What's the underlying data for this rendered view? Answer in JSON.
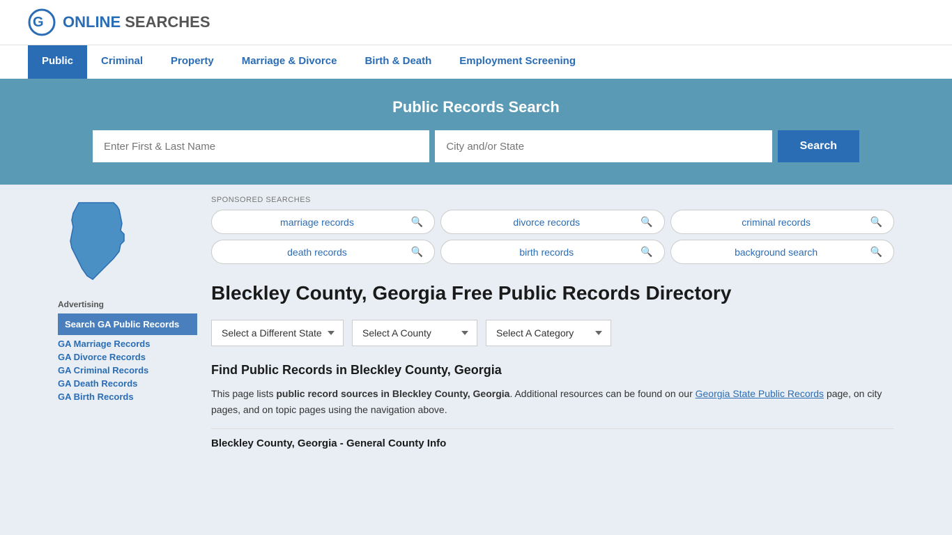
{
  "header": {
    "logo_brand": "ONLINE",
    "logo_brand2": "SEARCHES",
    "nav": [
      {
        "label": "Public",
        "active": true
      },
      {
        "label": "Criminal",
        "active": false
      },
      {
        "label": "Property",
        "active": false
      },
      {
        "label": "Marriage & Divorce",
        "active": false
      },
      {
        "label": "Birth & Death",
        "active": false
      },
      {
        "label": "Employment Screening",
        "active": false
      }
    ]
  },
  "hero": {
    "title": "Public Records Search",
    "name_placeholder": "Enter First & Last Name",
    "city_placeholder": "City and/or State",
    "search_label": "Search"
  },
  "sponsored": {
    "label": "SPONSORED SEARCHES",
    "items": [
      {
        "text": "marriage records"
      },
      {
        "text": "divorce records"
      },
      {
        "text": "criminal records"
      },
      {
        "text": "death records"
      },
      {
        "text": "birth records"
      },
      {
        "text": "background search"
      }
    ]
  },
  "page": {
    "title": "Bleckley County, Georgia Free Public Records Directory",
    "state_dropdown_label": "Select a Different State",
    "county_dropdown_label": "Select A County",
    "category_dropdown_label": "Select A Category",
    "find_heading": "Find Public Records in Bleckley County, Georgia",
    "find_body_1": "This page lists ",
    "find_body_bold": "public record sources in Bleckley County, Georgia",
    "find_body_2": ". Additional resources can be found on our ",
    "find_link": "Georgia State Public Records",
    "find_body_3": " page, on city pages, and on topic pages using the navigation above.",
    "general_info_heading": "Bleckley County, Georgia - General County Info"
  },
  "sidebar": {
    "ad_label": "Advertising",
    "highlight_text": "Search GA Public Records",
    "links": [
      {
        "text": "GA Marriage Records"
      },
      {
        "text": "GA Divorce Records"
      },
      {
        "text": "GA Criminal Records"
      },
      {
        "text": "GA Death Records"
      },
      {
        "text": "GA Birth Records"
      }
    ]
  },
  "colors": {
    "brand_blue": "#2a6db5",
    "hero_bg": "#5b9ab5",
    "nav_active_bg": "#2a6db5"
  }
}
